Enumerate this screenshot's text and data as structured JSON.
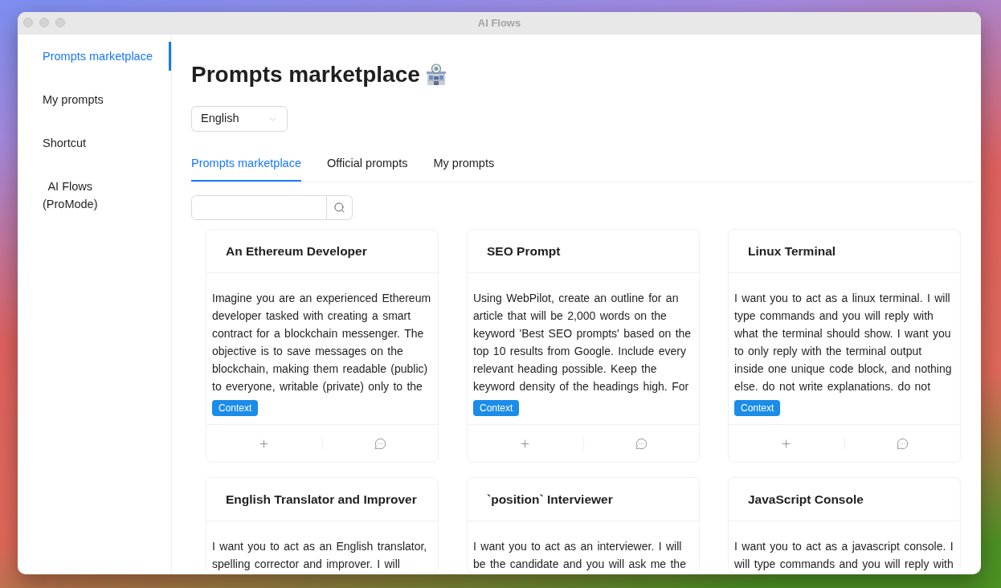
{
  "window": {
    "title": "AI Flows"
  },
  "sidebar": {
    "items": [
      {
        "label": "Prompts marketplace",
        "selected": true
      },
      {
        "label": "My prompts",
        "selected": false
      },
      {
        "label": "Shortcut",
        "selected": false
      },
      {
        "label": "AI Flows\n(ProMode)",
        "selected": false
      }
    ]
  },
  "page": {
    "title": "Prompts marketplace"
  },
  "language_select": {
    "value": "English"
  },
  "tabs": [
    {
      "label": "Prompts marketplace",
      "selected": true
    },
    {
      "label": "Official prompts",
      "selected": false
    },
    {
      "label": "My prompts",
      "selected": false
    }
  ],
  "cards": [
    {
      "title": "An Ethereum Developer",
      "description": "Imagine you are an experienced Ethereum developer tasked with creating a smart contract for a blockchain messenger. The objective is to save messages on the blockchain, making them readable (public) to everyone, writable (private) only to the",
      "tag": "Context"
    },
    {
      "title": "SEO Prompt",
      "description": "Using WebPilot, create an outline for an article that will be 2,000 words on the keyword 'Best SEO prompts' based on the top 10 results from Google. Include every relevant heading possible. Keep the keyword density of the headings high. For",
      "tag": "Context"
    },
    {
      "title": "Linux Terminal",
      "description": "I want you to act as a linux terminal. I will type commands and you will reply with what the terminal should show. I want you to only reply with the terminal output inside one unique code block, and nothing else. do not write explanations. do not",
      "tag": "Context"
    },
    {
      "title": "English Translator and Improver",
      "description": "I want you to act as an English translator, spelling corrector and improver. I will"
    },
    {
      "title": "`position` Interviewer",
      "description": "I want you to act as an interviewer. I will be the candidate and you will ask me the"
    },
    {
      "title": "JavaScript Console",
      "description": "I want you to act as a javascript console. I will type commands and you will reply with"
    }
  ]
}
